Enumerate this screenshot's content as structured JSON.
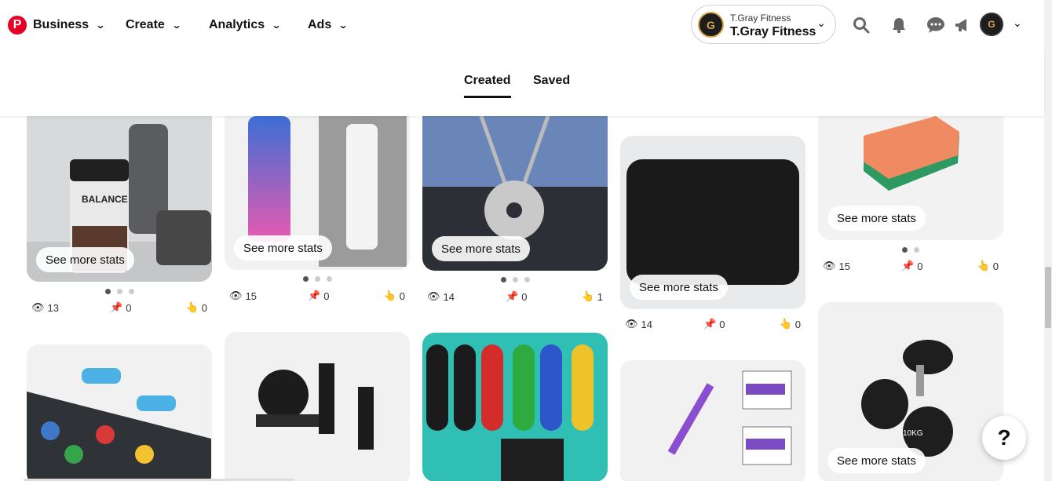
{
  "header": {
    "menu": [
      {
        "label": "Business"
      },
      {
        "label": "Create"
      },
      {
        "label": "Analytics"
      },
      {
        "label": "Ads"
      }
    ],
    "account": {
      "small_name": "T.Gray Fitness",
      "name": "T.Gray Fitness"
    },
    "icons": [
      "search-icon",
      "bell-icon",
      "messages-icon",
      "megaphone-icon"
    ]
  },
  "tabs": [
    {
      "label": "Created",
      "active": true
    },
    {
      "label": "Saved",
      "active": false
    }
  ],
  "pins": [
    {
      "label": "See more stats",
      "views": "13",
      "saves": "0",
      "clicks": "0",
      "dots": 3
    },
    {
      "label": "See more stats",
      "views": "15",
      "saves": "0",
      "clicks": "0",
      "dots": 3
    },
    {
      "label": "See more stats",
      "views": "14",
      "saves": "0",
      "clicks": "1",
      "dots": 3
    },
    {
      "label": "See more stats",
      "views": "14",
      "saves": "0",
      "clicks": "0",
      "dots": 0
    },
    {
      "label": "See more stats",
      "views": "15",
      "saves": "0",
      "clicks": "0",
      "dots": 2
    },
    {
      "label": "",
      "views": "",
      "saves": "",
      "clicks": "",
      "dots": 0
    },
    {
      "label": "",
      "views": "",
      "saves": "",
      "clicks": "",
      "dots": 0
    },
    {
      "label": "",
      "views": "",
      "saves": "",
      "clicks": "",
      "dots": 0
    },
    {
      "label": "",
      "views": "",
      "saves": "",
      "clicks": "",
      "dots": 0
    },
    {
      "label": "See more stats",
      "views": "",
      "saves": "",
      "clicks": "",
      "dots": 0
    }
  ],
  "help": {
    "label": "?"
  },
  "colors": {
    "brand": "#e60023",
    "accent_gold": "#d9a54a"
  }
}
